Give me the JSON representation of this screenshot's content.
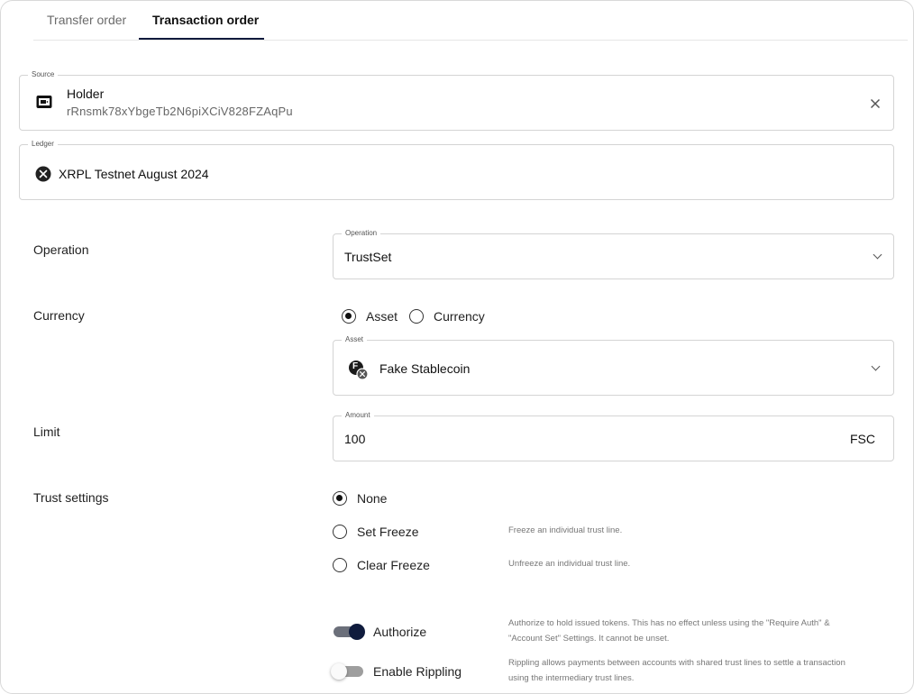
{
  "tabs": [
    {
      "label": "Transfer order",
      "active": false
    },
    {
      "label": "Transaction order",
      "active": true
    }
  ],
  "source": {
    "legend": "Source",
    "name": "Holder",
    "address": "rRnsmk78xYbgeTb2N6piXCiV828FZAqPu",
    "icon": "wallet-icon",
    "clear_icon": "close-icon"
  },
  "ledger": {
    "legend": "Ledger",
    "name": "XRPL Testnet August 2024",
    "icon": "xrpl-icon"
  },
  "operation": {
    "row_label": "Operation",
    "legend": "Operation",
    "value": "TrustSet"
  },
  "currency": {
    "row_label": "Currency",
    "options": [
      {
        "label": "Asset",
        "checked": true
      },
      {
        "label": "Currency",
        "checked": false
      }
    ],
    "asset_legend": "Asset",
    "asset_value": "Fake Stablecoin",
    "asset_icon_letter": "F"
  },
  "limit": {
    "row_label": "Limit",
    "legend": "Amount",
    "value": "100",
    "unit": "FSC"
  },
  "trust_settings": {
    "row_label": "Trust settings",
    "options": [
      {
        "label": "None",
        "checked": true,
        "hint": ""
      },
      {
        "label": "Set Freeze",
        "checked": false,
        "hint": "Freeze an individual trust line."
      },
      {
        "label": "Clear Freeze",
        "checked": false,
        "hint": "Unfreeze an individual trust line."
      }
    ],
    "toggles": [
      {
        "label": "Authorize",
        "on": true,
        "hint_line1": "Authorize to hold issued tokens. This has no effect unless using the \"Require Auth\" &",
        "hint_line2": "\"Account Set\" Settings. It cannot be unset."
      },
      {
        "label": "Enable Rippling",
        "on": false,
        "hint_line1": "Rippling allows payments between accounts with shared trust lines to settle a transaction",
        "hint_line2": "using the intermediary trust lines."
      }
    ]
  },
  "colors": {
    "accent": "#0f1b3d",
    "border": "#d4d4d4",
    "toggle_on_track": "#6b6f7a",
    "toggle_off_track": "#9e9e9e"
  }
}
